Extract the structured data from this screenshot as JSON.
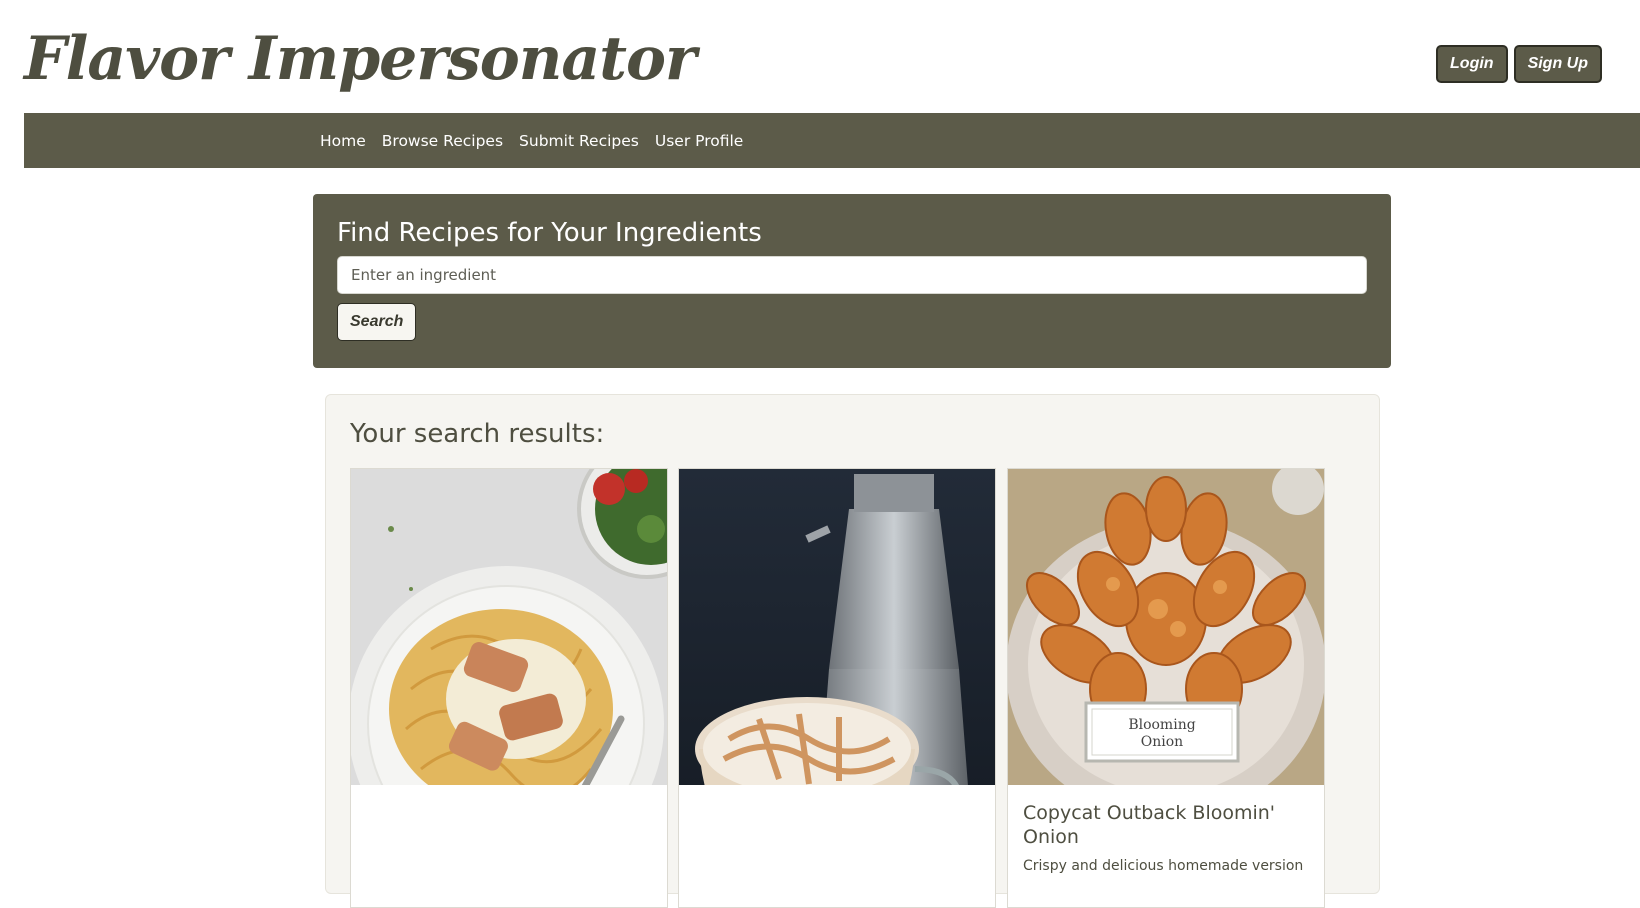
{
  "header": {
    "logo": "Flavor Impersonator",
    "login_label": "Login",
    "signup_label": "Sign Up"
  },
  "nav": {
    "items": [
      {
        "label": "Home"
      },
      {
        "label": "Browse Recipes"
      },
      {
        "label": "Submit Recipes"
      },
      {
        "label": "User Profile"
      }
    ]
  },
  "search": {
    "title": "Find Recipes for Your Ingredients",
    "placeholder": "Enter an ingredient",
    "value": "",
    "button_label": "Search"
  },
  "results": {
    "title": "Your search results:",
    "cards": [
      {
        "title": "",
        "description": ""
      },
      {
        "title": "",
        "description": ""
      },
      {
        "title": "Copycat Outback Bloomin' Onion",
        "description": "Crispy and delicious homemade version",
        "image_label": "Blooming Onion"
      }
    ]
  },
  "colors": {
    "primary": "#5c5b49",
    "panel_bg": "#f6f5f1",
    "text": "#4e4e40"
  }
}
